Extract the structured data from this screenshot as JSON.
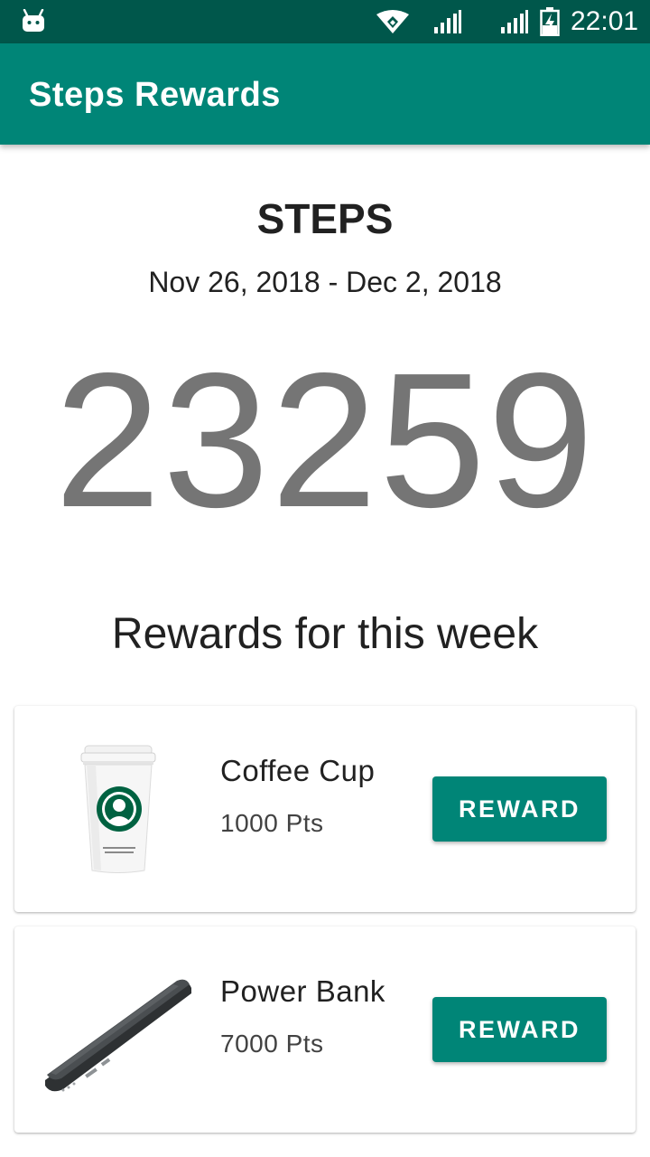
{
  "status_bar": {
    "time": "22:01",
    "icons": [
      "android-icon",
      "wifi-icon",
      "signal-icon",
      "signal-icon",
      "battery-charging-icon"
    ]
  },
  "app_bar": {
    "title": "Steps Rewards",
    "color": "#008577"
  },
  "steps": {
    "heading": "STEPS",
    "date_range": "Nov 26, 2018 - Dec 2, 2018",
    "count": "23259"
  },
  "rewards": {
    "heading": "Rewards for this week",
    "items": [
      {
        "name": "Coffee Cup",
        "points": "1000 Pts",
        "button_label": "REWARD",
        "image": "coffee-cup-image"
      },
      {
        "name": "Power Bank",
        "points": "7000 Pts",
        "button_label": "REWARD",
        "image": "power-bank-image"
      }
    ]
  },
  "colors": {
    "status_bar": "#00574B",
    "primary": "#008577",
    "steps_count": "#757575"
  }
}
